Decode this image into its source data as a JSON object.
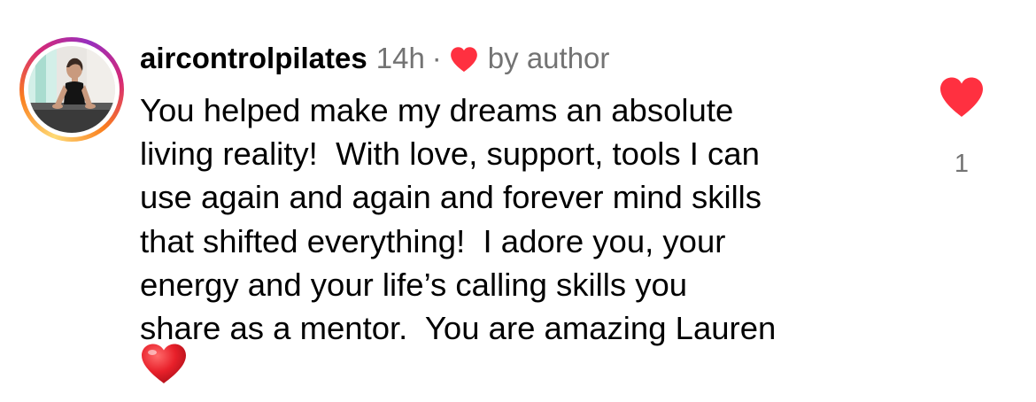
{
  "comment": {
    "username": "aircontrolpilates",
    "timestamp": "14h",
    "separator": "·",
    "author_badge": "by author",
    "body": "You helped make my dreams an absolute\nliving reality!  With love, support, tools I can\nuse again and again and forever mind skills\nthat shifted everything!  I adore you, your\nenergy and your life’s calling skills you\nshare as a mentor.  You are amazing Lauren",
    "emoji": "red-heart-emoji",
    "avatar_alt": "profile photo"
  },
  "like": {
    "icon": "heart-icon",
    "liked": true,
    "count": "1"
  },
  "colors": {
    "heart_red": "#ff3040",
    "secondary_text": "#737373",
    "primary_text": "#000000",
    "background": "#ffffff"
  }
}
